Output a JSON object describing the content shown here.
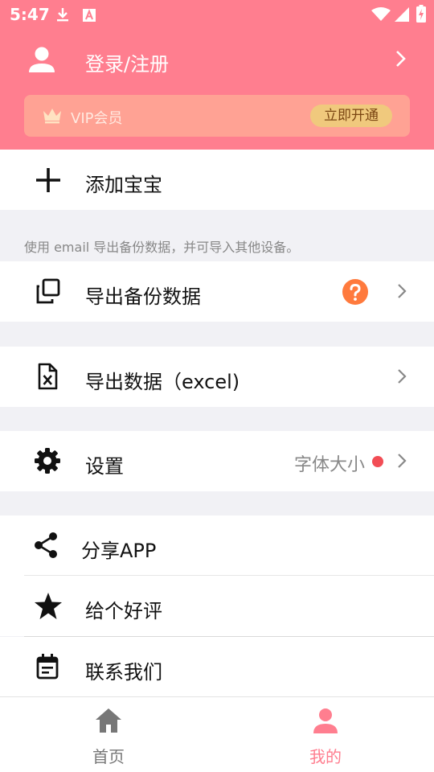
{
  "status_bar": {
    "time": "5:47"
  },
  "header": {
    "login_label": "登录/注册",
    "vip_label": "VIP会员",
    "vip_button": "立即开通"
  },
  "menu": {
    "add_baby": "添加宝宝",
    "backup_hint": "使用 email 导出备份数据，并可导入其他设备。",
    "export_backup": "导出备份数据",
    "export_excel": "导出数据（excel)",
    "settings": "设置",
    "font_size": "字体大小",
    "share_app": "分享APP",
    "rate": "给个好评",
    "contact": "联系我们"
  },
  "tabbar": {
    "tabs": [
      {
        "label": "首页",
        "icon": "home-icon",
        "active": false
      },
      {
        "label": "我的",
        "icon": "person-icon",
        "active": true
      }
    ]
  },
  "colors": {
    "header": "#ff7e8f",
    "vip_card": "#ffa294",
    "vip_button": "#f0c97d",
    "help": "#ff7a3d",
    "dot": "#f24d55",
    "tab_active": "#ff7e8f",
    "tab_inactive": "#777777"
  }
}
